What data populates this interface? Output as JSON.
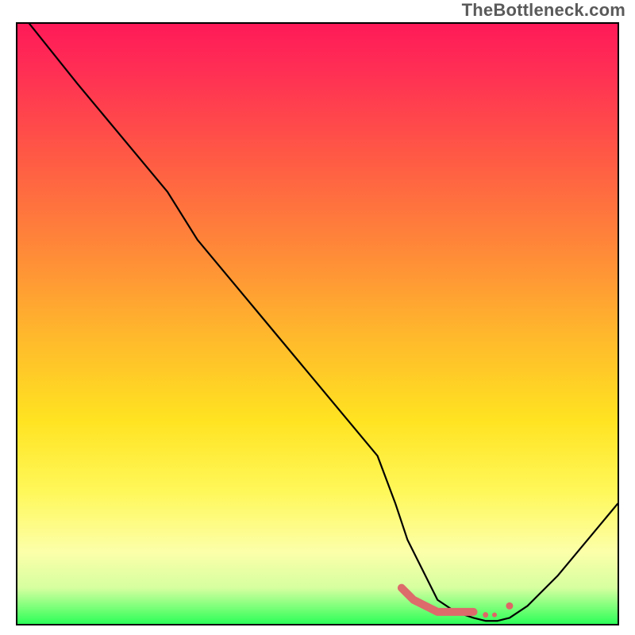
{
  "watermark": "TheBottleneck.com",
  "chart_data": {
    "type": "line",
    "title": "",
    "xlabel": "",
    "ylabel": "",
    "xlim": [
      0,
      100
    ],
    "ylim": [
      0,
      100
    ],
    "grid": false,
    "legend": false,
    "series": [
      {
        "name": "bottleneck-curve",
        "x": [
          2,
          10,
          20,
          25,
          30,
          40,
          50,
          60,
          63,
          65,
          68,
          70,
          73,
          76,
          78,
          80,
          82,
          85,
          90,
          95,
          100
        ],
        "y": [
          100,
          90,
          78,
          72,
          64,
          52,
          40,
          28,
          20,
          14,
          8,
          4,
          2,
          1,
          0.5,
          0.5,
          1,
          3,
          8,
          14,
          20
        ]
      }
    ],
    "highlight_points": {
      "name": "highlighted-segment",
      "color": "#e06666",
      "x": [
        64,
        66,
        68,
        70,
        72,
        74,
        76,
        80,
        82
      ],
      "y": [
        6,
        4,
        3,
        2,
        2,
        2,
        2,
        2,
        3
      ]
    },
    "gradient_stops": [
      {
        "pos": 0,
        "color": "#ff1a58"
      },
      {
        "pos": 8,
        "color": "#ff2f54"
      },
      {
        "pos": 22,
        "color": "#ff5945"
      },
      {
        "pos": 38,
        "color": "#ff8a38"
      },
      {
        "pos": 52,
        "color": "#ffb82c"
      },
      {
        "pos": 66,
        "color": "#ffe321"
      },
      {
        "pos": 78,
        "color": "#fff85a"
      },
      {
        "pos": 88,
        "color": "#fcffa9"
      },
      {
        "pos": 94,
        "color": "#d6ffa0"
      },
      {
        "pos": 100,
        "color": "#2dff58"
      }
    ]
  }
}
